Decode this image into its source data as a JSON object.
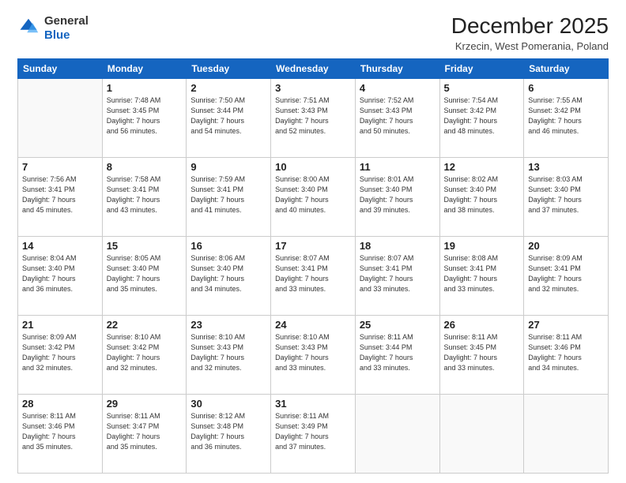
{
  "logo": {
    "general": "General",
    "blue": "Blue"
  },
  "title": "December 2025",
  "subtitle": "Krzecin, West Pomerania, Poland",
  "days_header": [
    "Sunday",
    "Monday",
    "Tuesday",
    "Wednesday",
    "Thursday",
    "Friday",
    "Saturday"
  ],
  "weeks": [
    [
      {
        "day": "",
        "info": ""
      },
      {
        "day": "1",
        "info": "Sunrise: 7:48 AM\nSunset: 3:45 PM\nDaylight: 7 hours\nand 56 minutes."
      },
      {
        "day": "2",
        "info": "Sunrise: 7:50 AM\nSunset: 3:44 PM\nDaylight: 7 hours\nand 54 minutes."
      },
      {
        "day": "3",
        "info": "Sunrise: 7:51 AM\nSunset: 3:43 PM\nDaylight: 7 hours\nand 52 minutes."
      },
      {
        "day": "4",
        "info": "Sunrise: 7:52 AM\nSunset: 3:43 PM\nDaylight: 7 hours\nand 50 minutes."
      },
      {
        "day": "5",
        "info": "Sunrise: 7:54 AM\nSunset: 3:42 PM\nDaylight: 7 hours\nand 48 minutes."
      },
      {
        "day": "6",
        "info": "Sunrise: 7:55 AM\nSunset: 3:42 PM\nDaylight: 7 hours\nand 46 minutes."
      }
    ],
    [
      {
        "day": "7",
        "info": "Sunrise: 7:56 AM\nSunset: 3:41 PM\nDaylight: 7 hours\nand 45 minutes."
      },
      {
        "day": "8",
        "info": "Sunrise: 7:58 AM\nSunset: 3:41 PM\nDaylight: 7 hours\nand 43 minutes."
      },
      {
        "day": "9",
        "info": "Sunrise: 7:59 AM\nSunset: 3:41 PM\nDaylight: 7 hours\nand 41 minutes."
      },
      {
        "day": "10",
        "info": "Sunrise: 8:00 AM\nSunset: 3:40 PM\nDaylight: 7 hours\nand 40 minutes."
      },
      {
        "day": "11",
        "info": "Sunrise: 8:01 AM\nSunset: 3:40 PM\nDaylight: 7 hours\nand 39 minutes."
      },
      {
        "day": "12",
        "info": "Sunrise: 8:02 AM\nSunset: 3:40 PM\nDaylight: 7 hours\nand 38 minutes."
      },
      {
        "day": "13",
        "info": "Sunrise: 8:03 AM\nSunset: 3:40 PM\nDaylight: 7 hours\nand 37 minutes."
      }
    ],
    [
      {
        "day": "14",
        "info": "Sunrise: 8:04 AM\nSunset: 3:40 PM\nDaylight: 7 hours\nand 36 minutes."
      },
      {
        "day": "15",
        "info": "Sunrise: 8:05 AM\nSunset: 3:40 PM\nDaylight: 7 hours\nand 35 minutes."
      },
      {
        "day": "16",
        "info": "Sunrise: 8:06 AM\nSunset: 3:40 PM\nDaylight: 7 hours\nand 34 minutes."
      },
      {
        "day": "17",
        "info": "Sunrise: 8:07 AM\nSunset: 3:41 PM\nDaylight: 7 hours\nand 33 minutes."
      },
      {
        "day": "18",
        "info": "Sunrise: 8:07 AM\nSunset: 3:41 PM\nDaylight: 7 hours\nand 33 minutes."
      },
      {
        "day": "19",
        "info": "Sunrise: 8:08 AM\nSunset: 3:41 PM\nDaylight: 7 hours\nand 33 minutes."
      },
      {
        "day": "20",
        "info": "Sunrise: 8:09 AM\nSunset: 3:41 PM\nDaylight: 7 hours\nand 32 minutes."
      }
    ],
    [
      {
        "day": "21",
        "info": "Sunrise: 8:09 AM\nSunset: 3:42 PM\nDaylight: 7 hours\nand 32 minutes."
      },
      {
        "day": "22",
        "info": "Sunrise: 8:10 AM\nSunset: 3:42 PM\nDaylight: 7 hours\nand 32 minutes."
      },
      {
        "day": "23",
        "info": "Sunrise: 8:10 AM\nSunset: 3:43 PM\nDaylight: 7 hours\nand 32 minutes."
      },
      {
        "day": "24",
        "info": "Sunrise: 8:10 AM\nSunset: 3:43 PM\nDaylight: 7 hours\nand 33 minutes."
      },
      {
        "day": "25",
        "info": "Sunrise: 8:11 AM\nSunset: 3:44 PM\nDaylight: 7 hours\nand 33 minutes."
      },
      {
        "day": "26",
        "info": "Sunrise: 8:11 AM\nSunset: 3:45 PM\nDaylight: 7 hours\nand 33 minutes."
      },
      {
        "day": "27",
        "info": "Sunrise: 8:11 AM\nSunset: 3:46 PM\nDaylight: 7 hours\nand 34 minutes."
      }
    ],
    [
      {
        "day": "28",
        "info": "Sunrise: 8:11 AM\nSunset: 3:46 PM\nDaylight: 7 hours\nand 35 minutes."
      },
      {
        "day": "29",
        "info": "Sunrise: 8:11 AM\nSunset: 3:47 PM\nDaylight: 7 hours\nand 35 minutes."
      },
      {
        "day": "30",
        "info": "Sunrise: 8:12 AM\nSunset: 3:48 PM\nDaylight: 7 hours\nand 36 minutes."
      },
      {
        "day": "31",
        "info": "Sunrise: 8:11 AM\nSunset: 3:49 PM\nDaylight: 7 hours\nand 37 minutes."
      },
      {
        "day": "",
        "info": ""
      },
      {
        "day": "",
        "info": ""
      },
      {
        "day": "",
        "info": ""
      }
    ]
  ]
}
